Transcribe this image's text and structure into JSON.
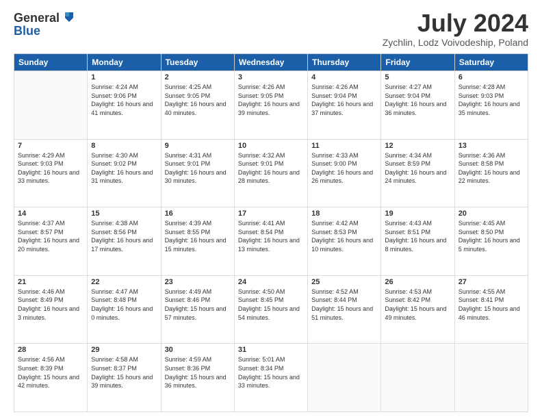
{
  "header": {
    "logo_line1": "General",
    "logo_line2": "Blue",
    "title": "July 2024",
    "subtitle": "Zychlin, Lodz Voivodeship, Poland"
  },
  "weekdays": [
    "Sunday",
    "Monday",
    "Tuesday",
    "Wednesday",
    "Thursday",
    "Friday",
    "Saturday"
  ],
  "weeks": [
    {
      "days": [
        {
          "day": "",
          "sunrise": "",
          "sunset": "",
          "daylight": ""
        },
        {
          "day": "1",
          "sunrise": "Sunrise: 4:24 AM",
          "sunset": "Sunset: 9:06 PM",
          "daylight": "Daylight: 16 hours and 41 minutes."
        },
        {
          "day": "2",
          "sunrise": "Sunrise: 4:25 AM",
          "sunset": "Sunset: 9:05 PM",
          "daylight": "Daylight: 16 hours and 40 minutes."
        },
        {
          "day": "3",
          "sunrise": "Sunrise: 4:26 AM",
          "sunset": "Sunset: 9:05 PM",
          "daylight": "Daylight: 16 hours and 39 minutes."
        },
        {
          "day": "4",
          "sunrise": "Sunrise: 4:26 AM",
          "sunset": "Sunset: 9:04 PM",
          "daylight": "Daylight: 16 hours and 37 minutes."
        },
        {
          "day": "5",
          "sunrise": "Sunrise: 4:27 AM",
          "sunset": "Sunset: 9:04 PM",
          "daylight": "Daylight: 16 hours and 36 minutes."
        },
        {
          "day": "6",
          "sunrise": "Sunrise: 4:28 AM",
          "sunset": "Sunset: 9:03 PM",
          "daylight": "Daylight: 16 hours and 35 minutes."
        }
      ]
    },
    {
      "days": [
        {
          "day": "7",
          "sunrise": "Sunrise: 4:29 AM",
          "sunset": "Sunset: 9:03 PM",
          "daylight": "Daylight: 16 hours and 33 minutes."
        },
        {
          "day": "8",
          "sunrise": "Sunrise: 4:30 AM",
          "sunset": "Sunset: 9:02 PM",
          "daylight": "Daylight: 16 hours and 31 minutes."
        },
        {
          "day": "9",
          "sunrise": "Sunrise: 4:31 AM",
          "sunset": "Sunset: 9:01 PM",
          "daylight": "Daylight: 16 hours and 30 minutes."
        },
        {
          "day": "10",
          "sunrise": "Sunrise: 4:32 AM",
          "sunset": "Sunset: 9:01 PM",
          "daylight": "Daylight: 16 hours and 28 minutes."
        },
        {
          "day": "11",
          "sunrise": "Sunrise: 4:33 AM",
          "sunset": "Sunset: 9:00 PM",
          "daylight": "Daylight: 16 hours and 26 minutes."
        },
        {
          "day": "12",
          "sunrise": "Sunrise: 4:34 AM",
          "sunset": "Sunset: 8:59 PM",
          "daylight": "Daylight: 16 hours and 24 minutes."
        },
        {
          "day": "13",
          "sunrise": "Sunrise: 4:36 AM",
          "sunset": "Sunset: 8:58 PM",
          "daylight": "Daylight: 16 hours and 22 minutes."
        }
      ]
    },
    {
      "days": [
        {
          "day": "14",
          "sunrise": "Sunrise: 4:37 AM",
          "sunset": "Sunset: 8:57 PM",
          "daylight": "Daylight: 16 hours and 20 minutes."
        },
        {
          "day": "15",
          "sunrise": "Sunrise: 4:38 AM",
          "sunset": "Sunset: 8:56 PM",
          "daylight": "Daylight: 16 hours and 17 minutes."
        },
        {
          "day": "16",
          "sunrise": "Sunrise: 4:39 AM",
          "sunset": "Sunset: 8:55 PM",
          "daylight": "Daylight: 16 hours and 15 minutes."
        },
        {
          "day": "17",
          "sunrise": "Sunrise: 4:41 AM",
          "sunset": "Sunset: 8:54 PM",
          "daylight": "Daylight: 16 hours and 13 minutes."
        },
        {
          "day": "18",
          "sunrise": "Sunrise: 4:42 AM",
          "sunset": "Sunset: 8:53 PM",
          "daylight": "Daylight: 16 hours and 10 minutes."
        },
        {
          "day": "19",
          "sunrise": "Sunrise: 4:43 AM",
          "sunset": "Sunset: 8:51 PM",
          "daylight": "Daylight: 16 hours and 8 minutes."
        },
        {
          "day": "20",
          "sunrise": "Sunrise: 4:45 AM",
          "sunset": "Sunset: 8:50 PM",
          "daylight": "Daylight: 16 hours and 5 minutes."
        }
      ]
    },
    {
      "days": [
        {
          "day": "21",
          "sunrise": "Sunrise: 4:46 AM",
          "sunset": "Sunset: 8:49 PM",
          "daylight": "Daylight: 16 hours and 3 minutes."
        },
        {
          "day": "22",
          "sunrise": "Sunrise: 4:47 AM",
          "sunset": "Sunset: 8:48 PM",
          "daylight": "Daylight: 16 hours and 0 minutes."
        },
        {
          "day": "23",
          "sunrise": "Sunrise: 4:49 AM",
          "sunset": "Sunset: 8:46 PM",
          "daylight": "Daylight: 15 hours and 57 minutes."
        },
        {
          "day": "24",
          "sunrise": "Sunrise: 4:50 AM",
          "sunset": "Sunset: 8:45 PM",
          "daylight": "Daylight: 15 hours and 54 minutes."
        },
        {
          "day": "25",
          "sunrise": "Sunrise: 4:52 AM",
          "sunset": "Sunset: 8:44 PM",
          "daylight": "Daylight: 15 hours and 51 minutes."
        },
        {
          "day": "26",
          "sunrise": "Sunrise: 4:53 AM",
          "sunset": "Sunset: 8:42 PM",
          "daylight": "Daylight: 15 hours and 49 minutes."
        },
        {
          "day": "27",
          "sunrise": "Sunrise: 4:55 AM",
          "sunset": "Sunset: 8:41 PM",
          "daylight": "Daylight: 15 hours and 46 minutes."
        }
      ]
    },
    {
      "days": [
        {
          "day": "28",
          "sunrise": "Sunrise: 4:56 AM",
          "sunset": "Sunset: 8:39 PM",
          "daylight": "Daylight: 15 hours and 42 minutes."
        },
        {
          "day": "29",
          "sunrise": "Sunrise: 4:58 AM",
          "sunset": "Sunset: 8:37 PM",
          "daylight": "Daylight: 15 hours and 39 minutes."
        },
        {
          "day": "30",
          "sunrise": "Sunrise: 4:59 AM",
          "sunset": "Sunset: 8:36 PM",
          "daylight": "Daylight: 15 hours and 36 minutes."
        },
        {
          "day": "31",
          "sunrise": "Sunrise: 5:01 AM",
          "sunset": "Sunset: 8:34 PM",
          "daylight": "Daylight: 15 hours and 33 minutes."
        },
        {
          "day": "",
          "sunrise": "",
          "sunset": "",
          "daylight": ""
        },
        {
          "day": "",
          "sunrise": "",
          "sunset": "",
          "daylight": ""
        },
        {
          "day": "",
          "sunrise": "",
          "sunset": "",
          "daylight": ""
        }
      ]
    }
  ]
}
